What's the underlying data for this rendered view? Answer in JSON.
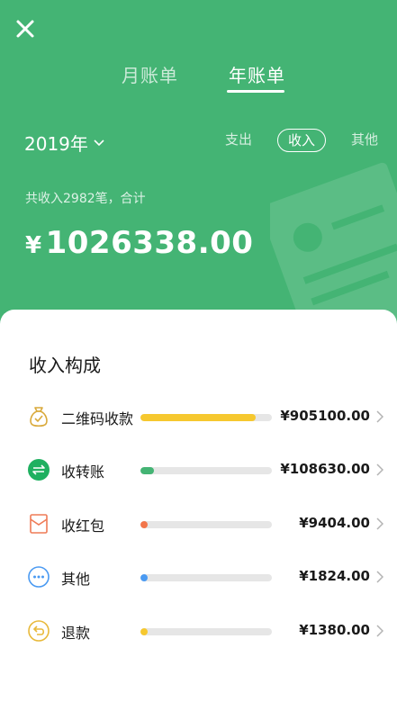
{
  "header": {
    "tabs": [
      {
        "label": "月账单",
        "active": false
      },
      {
        "label": "年账单",
        "active": true
      }
    ],
    "year": "2019年",
    "filters": {
      "expense": "支出",
      "income": "收入",
      "other": "其他",
      "selected": "income"
    },
    "summary": "共收入2982笔，合计",
    "currency": "¥",
    "total": "1026338.00",
    "colors": {
      "header_bg": "#44b474",
      "text": "#ffffff"
    }
  },
  "breakdown": {
    "title": "收入构成",
    "items": [
      {
        "label": "二维码收款",
        "value": "¥905100.00",
        "icon": "money-bag-icon",
        "share": 0.88,
        "color": "#f6c82f"
      },
      {
        "label": "收转账",
        "value": "¥108630.00",
        "icon": "transfer-icon",
        "share": 0.106,
        "color": "#44b474"
      },
      {
        "label": "收红包",
        "value": "¥9404.00",
        "icon": "red-packet-icon",
        "share": 0.009,
        "color": "#f2754a"
      },
      {
        "label": "其他",
        "value": "¥1824.00",
        "icon": "more-icon",
        "share": 0.002,
        "color": "#4a9af2"
      },
      {
        "label": "退款",
        "value": "¥1380.00",
        "icon": "refund-icon",
        "share": 0.001,
        "color": "#f6c82f"
      }
    ]
  }
}
